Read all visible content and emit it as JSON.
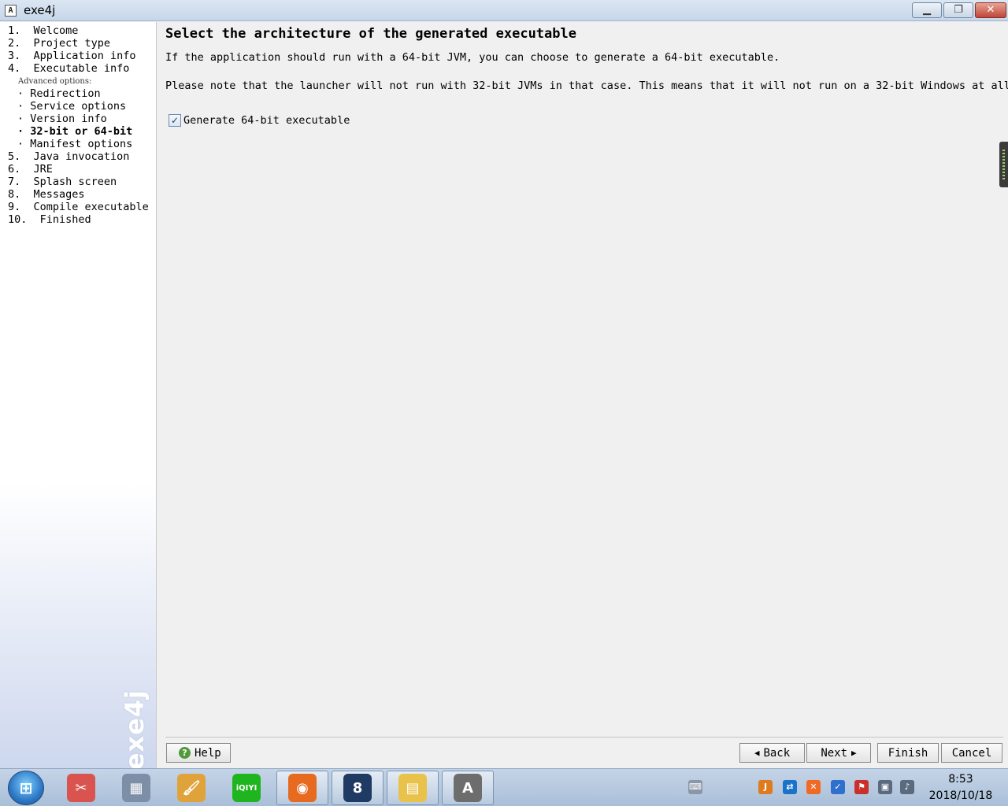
{
  "window": {
    "icon_letter": "A",
    "title": "exe4j",
    "controls": {
      "minimize": "▁",
      "maximize": "❐",
      "close": "✕"
    }
  },
  "nav": {
    "steps": [
      "1.  Welcome",
      "2.  Project type",
      "3.  Application info",
      "4.  Executable info"
    ],
    "advanced_label": "Advanced options:",
    "advanced_items": [
      "· Redirection",
      "· Service options",
      "· Version info",
      "· 32-bit or 64-bit",
      "· Manifest options"
    ],
    "active_advanced_index": 3,
    "steps_after": [
      "5.  Java invocation",
      "6.  JRE",
      "7.  Splash screen",
      "8.  Messages",
      "9.  Compile executable",
      "10.  Finished"
    ],
    "brand": "exe4j"
  },
  "content": {
    "heading": "Select the architecture of the generated executable",
    "paragraph1": "If the application should run with a 64-bit JVM, you can choose to generate a 64-bit executable.",
    "paragraph2": "Please note that the launcher will not run with 32-bit JVMs in that case. This means that it will not run on a 32-bit Windows at all.",
    "checkbox": {
      "label": "Generate 64-bit executable",
      "checked": true,
      "check_glyph": "✓"
    }
  },
  "buttons": {
    "help": "Help",
    "help_glyph": "?",
    "back": "Back",
    "next": "Next",
    "finish": "Finish",
    "cancel": "Cancel",
    "back_arrow": "◀",
    "next_arrow": "▶"
  },
  "taskbar": {
    "start_glyph": "⊞",
    "apps": [
      {
        "name": "snipping-tool-icon",
        "glyph": "✂",
        "color": "#d9534f",
        "open": false
      },
      {
        "name": "calculator-icon",
        "glyph": "▦",
        "color": "#7d8fa6",
        "open": false
      },
      {
        "name": "paint-icon",
        "glyph": "🖌",
        "color": "#e0a33b",
        "open": false
      },
      {
        "name": "iqiyi-icon",
        "glyph": "iQIYI",
        "color": "#1fb51f",
        "open": false
      },
      {
        "name": "firefox-icon",
        "glyph": "◉",
        "color": "#e66a1f",
        "open": true
      },
      {
        "name": "eclipse-8-icon",
        "glyph": "8",
        "color": "#1f3a63",
        "open": true
      },
      {
        "name": "file-explorer-icon",
        "glyph": "▤",
        "color": "#e8c24a",
        "open": true
      },
      {
        "name": "exe4j-window-icon",
        "glyph": "A",
        "color": "#6d6d6d",
        "open": true
      }
    ],
    "tray": [
      {
        "name": "keyboard-icon",
        "glyph": "⌨",
        "color": "#8b97a8"
      },
      {
        "name": "java-icon",
        "glyph": "J",
        "color": "#e07a1f"
      },
      {
        "name": "teamviewer-icon",
        "glyph": "⇄",
        "color": "#1a73c9"
      },
      {
        "name": "xunlei-icon",
        "glyph": "✕",
        "color": "#f06a24"
      },
      {
        "name": "shield-icon",
        "glyph": "✓",
        "color": "#2f6fcf"
      },
      {
        "name": "flag-icon",
        "glyph": "⚑",
        "color": "#c9302c"
      },
      {
        "name": "network-icon",
        "glyph": "▣",
        "color": "#5a6b80"
      },
      {
        "name": "volume-icon",
        "glyph": "♪",
        "color": "#5a6b80"
      }
    ],
    "time": "8:53",
    "date": "2018/10/18"
  }
}
